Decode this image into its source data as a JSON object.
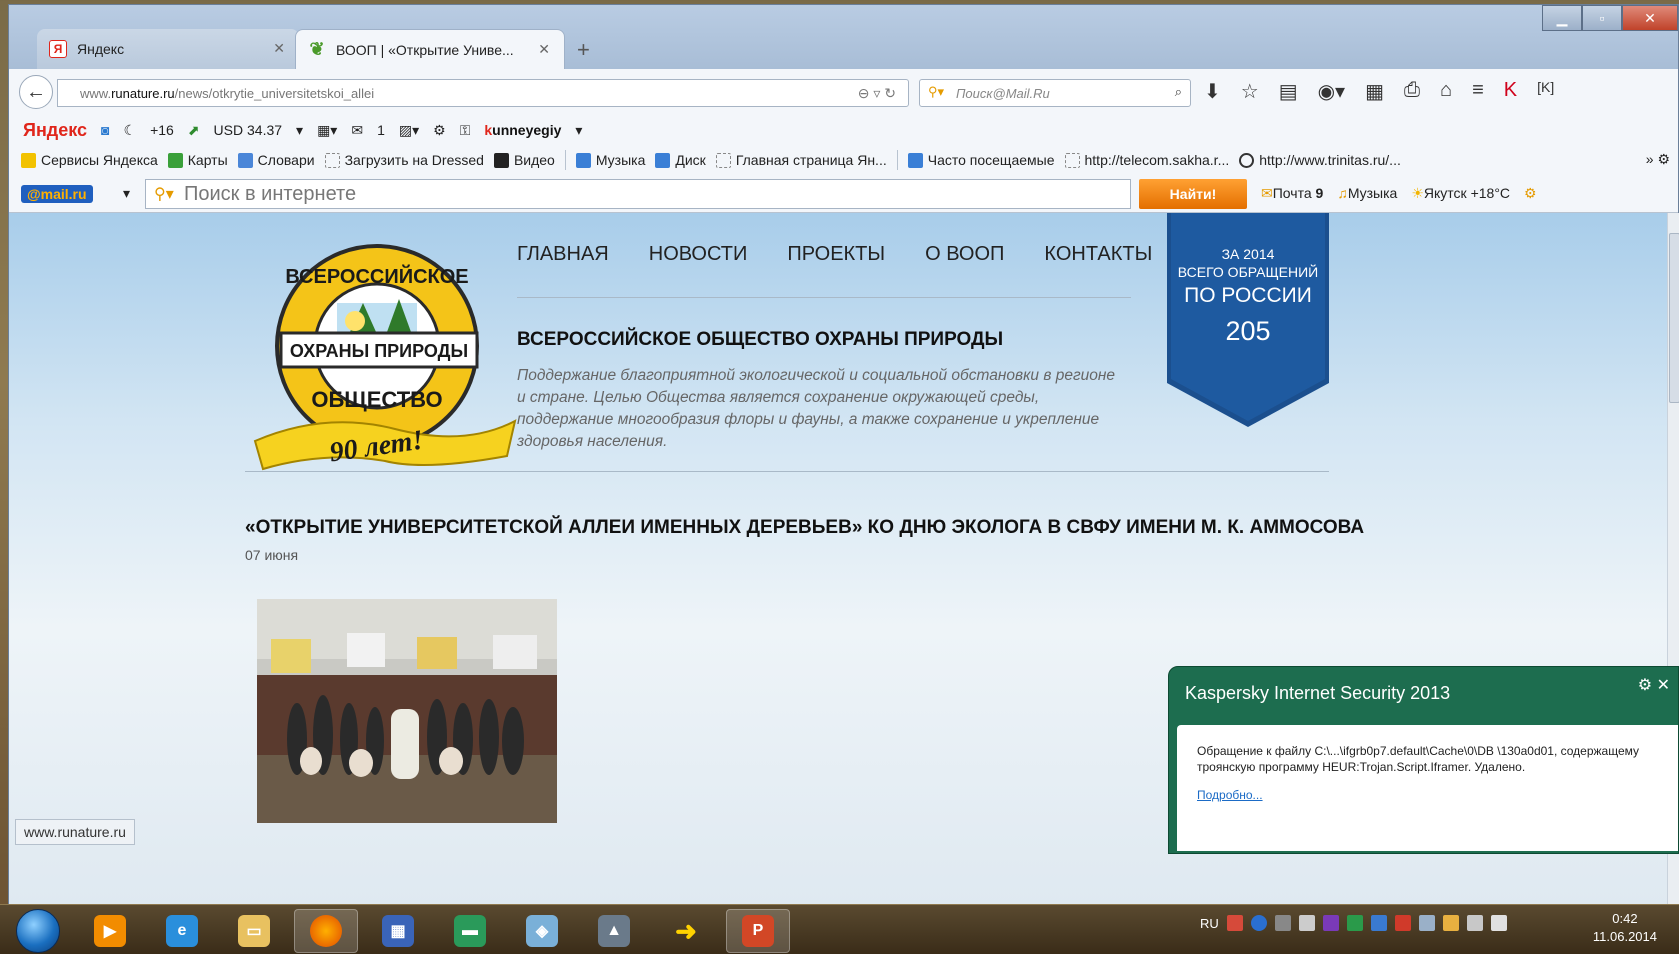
{
  "browser": {
    "tabs": [
      {
        "label": "Яндекс",
        "favicon": "yandex-icon"
      },
      {
        "label": "ВООП | «Открытие Униве...",
        "favicon": "leaf-icon"
      }
    ],
    "url_prefix": "www.",
    "url_domain": "runature.ru",
    "url_path": "/news/otkrytie_universitetskoi_allei",
    "search_placeholder": "Поиск@Mail.Ru"
  },
  "yandex_bar": {
    "logo": "Яндекс",
    "weather": "+16",
    "currency": "USD 34.37",
    "mail_count": "1",
    "user": "kunneyegiy"
  },
  "bookmarks": [
    {
      "label": "Сервисы Яндекса",
      "color": "#f2c200"
    },
    {
      "label": "Карты",
      "color": "#3aa03a"
    },
    {
      "label": "Словари",
      "color": "#4a86d8"
    },
    {
      "label": "Загрузить на Dressed",
      "color": "#ffffff"
    },
    {
      "label": "Видео",
      "color": "#222222"
    },
    {
      "label": "Музыка",
      "color": "#3a7fd6"
    },
    {
      "label": "Диск",
      "color": "#3a7fd6"
    },
    {
      "label": "Главная страница Ян...",
      "color": "#ffffff"
    },
    {
      "label": "Часто посещаемые",
      "color": "#3a7fd6"
    },
    {
      "label": "http://telecom.sakha.r...",
      "color": "#ffffff"
    },
    {
      "label": "http://www.trinitas.ru/...",
      "color": "#333333"
    }
  ],
  "mail_bar": {
    "logo_at": "@mail",
    "logo_ru": ".ru",
    "search_placeholder": "Поиск в интернете",
    "find_button": "Найти!",
    "mail_label": "Почта",
    "mail_count": "9",
    "music_label": "Музыка",
    "weather": "Якутск +18°C"
  },
  "site": {
    "logo_top": "ВСЕРОССИЙСКОЕ",
    "logo_middle": "ОХРАНЫ ПРИРОДЫ",
    "logo_bottom": "ОБЩЕСТВО",
    "logo_ribbon": "90 лет!",
    "nav": [
      "ГЛАВНАЯ",
      "НОВОСТИ",
      "ПРОЕКТЫ",
      "О ВООП",
      "КОНТАКТЫ"
    ],
    "title": "ВСЕРОССИЙСКОЕ ОБЩЕСТВО ОХРАНЫ ПРИРОДЫ",
    "description": "Поддержание благоприятной экологической и социальной обстановки в регионе и стране. Целью Общества является сохранение окружающей среды, поддержание многообразия флоры и фауны, а также сохранение и укрепление здоровья населения.",
    "stats": {
      "line1": "ЗА 2014",
      "line2": "ВСЕГО ОБРАЩЕНИЙ",
      "line3": "ПО РОССИИ",
      "value": "205"
    },
    "article_title": "«ОТКРЫТИЕ УНИВЕРСИТЕТСКОЙ АЛЛЕИ ИМЕННЫХ ДЕРЕВЬЕВ» КО ДНЮ ЭКОЛОГА В СВФУ ИМЕНИ М. К. АММОСОВА",
    "article_date": "07 июня"
  },
  "status_url": "www.runature.ru",
  "kaspersky": {
    "title": "Kaspersky Internet Security 2013",
    "message": "Обращение к файлу C:\\...\\ifgrb0p7.default\\Cache\\0\\DB \\130a0d01, содержащему троянскую программу HEUR:Trojan.Script.Iframer. Удалено.",
    "link": "Подробно..."
  },
  "taskbar": {
    "language": "RU",
    "time": "0:42",
    "date": "11.06.2014"
  }
}
